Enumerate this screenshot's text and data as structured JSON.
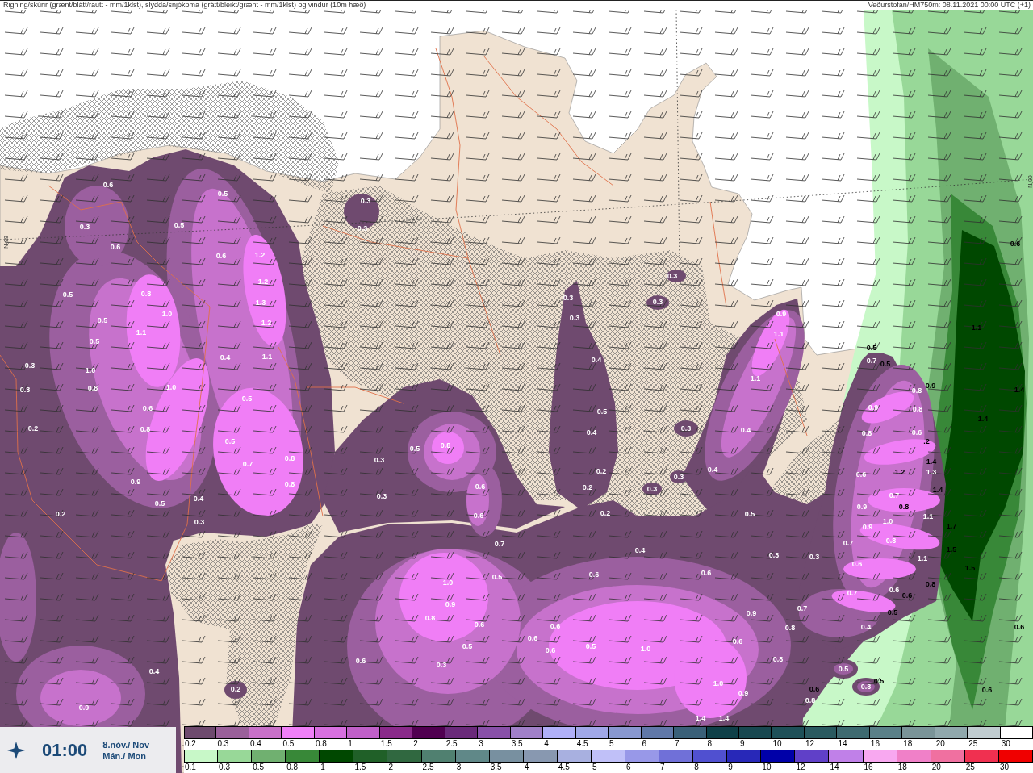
{
  "header": {
    "title": "Rigning/skúrir (grænt/blátt/rautt - mm/1klst), slydda/snjókoma (grátt/bleikt/grænt - mm/1klst) og vindur (10m hæð)",
    "source": "Veðurstofan/HM750m: 08.11.2021 00:00 UTC (+1)"
  },
  "map": {
    "latitude_labels": [
      "66°N",
      "66°N"
    ],
    "snow_labels": [
      "0.6",
      "0.5",
      "0.3",
      "0.3",
      "0.5",
      "0.3",
      "0.6",
      "0.6",
      "1.2",
      "0.3",
      "1.2",
      "0.5",
      "0.8",
      "1.3",
      "0.3",
      "0.3",
      "0.5",
      "1.0",
      "1.2",
      "0.3",
      "0.9",
      "1.1",
      "1.1",
      "0.5",
      "0.4",
      "1.1",
      "0.4",
      "0.7",
      "0.3",
      "1.0",
      "1.1",
      "0.3",
      "0.8",
      "1.0",
      "0.8",
      "0.5",
      "0.6",
      "0.5",
      "0.9",
      "0.8",
      "0.2",
      "0.8",
      "0.4",
      "0.3",
      "0.4",
      "0.8",
      "0.6",
      "0.5",
      "0.5",
      "0.8",
      "0.7",
      "0.8",
      "0.3",
      "0.9",
      "0.8",
      "0.6",
      "0.2",
      "0.2",
      "0.3",
      "0.3",
      "0.4",
      "0.6",
      "1.3",
      "0.4",
      "0.3",
      "0.7",
      "0.5",
      "0.9",
      "0.2",
      "0.3",
      "0.6",
      "0.2",
      "0.5",
      "0.9",
      "1.0",
      "1.1",
      "0.7",
      "0.7",
      "0.8",
      "0.4",
      "0.3",
      "0.3",
      "1.1",
      "0.6",
      "0.5",
      "0.6",
      "0.6",
      "1.0",
      "0.7",
      "0.6",
      "0.8",
      "0.9",
      "0.9",
      "0.7",
      "0.6",
      "0.6",
      "0.8",
      "0.4",
      "0.5",
      "0.6",
      "0.6",
      "0.5",
      "1.0",
      "0.6",
      "0.4",
      "0.6",
      "0.3",
      "0.8",
      "0.5",
      "0.2",
      "1.0",
      "0.9",
      "0.3",
      "0.8",
      "0.9",
      "1.4",
      "1.4"
    ],
    "rain_labels": [
      "0.6",
      "1.1",
      "0.5",
      "0.5",
      "0.9",
      "1.4",
      "1.4",
      ".2",
      "1.4",
      "1.2",
      "1.4",
      "0.8",
      "1.7",
      "1.5",
      "1.5",
      "0.8",
      "0.6",
      "0.5",
      "0.6",
      "0.6",
      "0.5",
      "0.6"
    ]
  },
  "time_panel": {
    "time": "01:00",
    "date": "8.nóv./ Nov",
    "weekday": "Mán./ Mon"
  },
  "legend": {
    "snow": [
      {
        "label": "0.2",
        "color": "#6e4a6e"
      },
      {
        "label": "0.3",
        "color": "#9a609a"
      },
      {
        "label": "0.4",
        "color": "#c870c8"
      },
      {
        "label": "0.5",
        "color": "#f080f8"
      },
      {
        "label": "0.8",
        "color": "#d870e0"
      },
      {
        "label": "1",
        "color": "#c060c8"
      },
      {
        "label": "1.5",
        "color": "#8a2a8a"
      },
      {
        "label": "2",
        "color": "#500050"
      },
      {
        "label": "2.5",
        "color": "#6a2a7a"
      },
      {
        "label": "3",
        "color": "#8850a8"
      },
      {
        "label": "3.5",
        "color": "#a080c8"
      },
      {
        "label": "4",
        "color": "#b0b0f8"
      },
      {
        "label": "4.5",
        "color": "#a0a8e8"
      },
      {
        "label": "5",
        "color": "#8898d0"
      },
      {
        "label": "6",
        "color": "#6078a8"
      },
      {
        "label": "7",
        "color": "#3a6078"
      },
      {
        "label": "8",
        "color": "#0e4048"
      },
      {
        "label": "9",
        "color": "#184850"
      },
      {
        "label": "10",
        "color": "#1e5058"
      },
      {
        "label": "12",
        "color": "#2a5a60"
      },
      {
        "label": "14",
        "color": "#3e6a70"
      },
      {
        "label": "16",
        "color": "#5a8088"
      },
      {
        "label": "18",
        "color": "#7a9498"
      },
      {
        "label": "20",
        "color": "#90a8ac"
      },
      {
        "label": "25",
        "color": "#c0ccd0"
      },
      {
        "label": "30",
        "color": "#ffffff"
      }
    ],
    "rain": [
      {
        "label": "0.1",
        "color": "#c8f8c8"
      },
      {
        "label": "0.3",
        "color": "#98d898"
      },
      {
        "label": "0.5",
        "color": "#70b070"
      },
      {
        "label": "0.8",
        "color": "#388838"
      },
      {
        "label": "1",
        "color": "#004800"
      },
      {
        "label": "1.5",
        "color": "#206028"
      },
      {
        "label": "2",
        "color": "#306840"
      },
      {
        "label": "2.5",
        "color": "#508070"
      },
      {
        "label": "3",
        "color": "#608888"
      },
      {
        "label": "3.5",
        "color": "#7890a0"
      },
      {
        "label": "4",
        "color": "#8898b0"
      },
      {
        "label": "4.5",
        "color": "#a8b0e0"
      },
      {
        "label": "5",
        "color": "#c0c0f8"
      },
      {
        "label": "6",
        "color": "#9898e8"
      },
      {
        "label": "7",
        "color": "#7070d8"
      },
      {
        "label": "8",
        "color": "#5050d0"
      },
      {
        "label": "9",
        "color": "#2828b8"
      },
      {
        "label": "10",
        "color": "#0000a8"
      },
      {
        "label": "12",
        "color": "#6040c8"
      },
      {
        "label": "14",
        "color": "#c080e8"
      },
      {
        "label": "16",
        "color": "#f8a8f0"
      },
      {
        "label": "18",
        "color": "#f080c8"
      },
      {
        "label": "20",
        "color": "#f070a0"
      },
      {
        "label": "25",
        "color": "#f03050"
      },
      {
        "label": "30",
        "color": "#f00000"
      }
    ]
  }
}
